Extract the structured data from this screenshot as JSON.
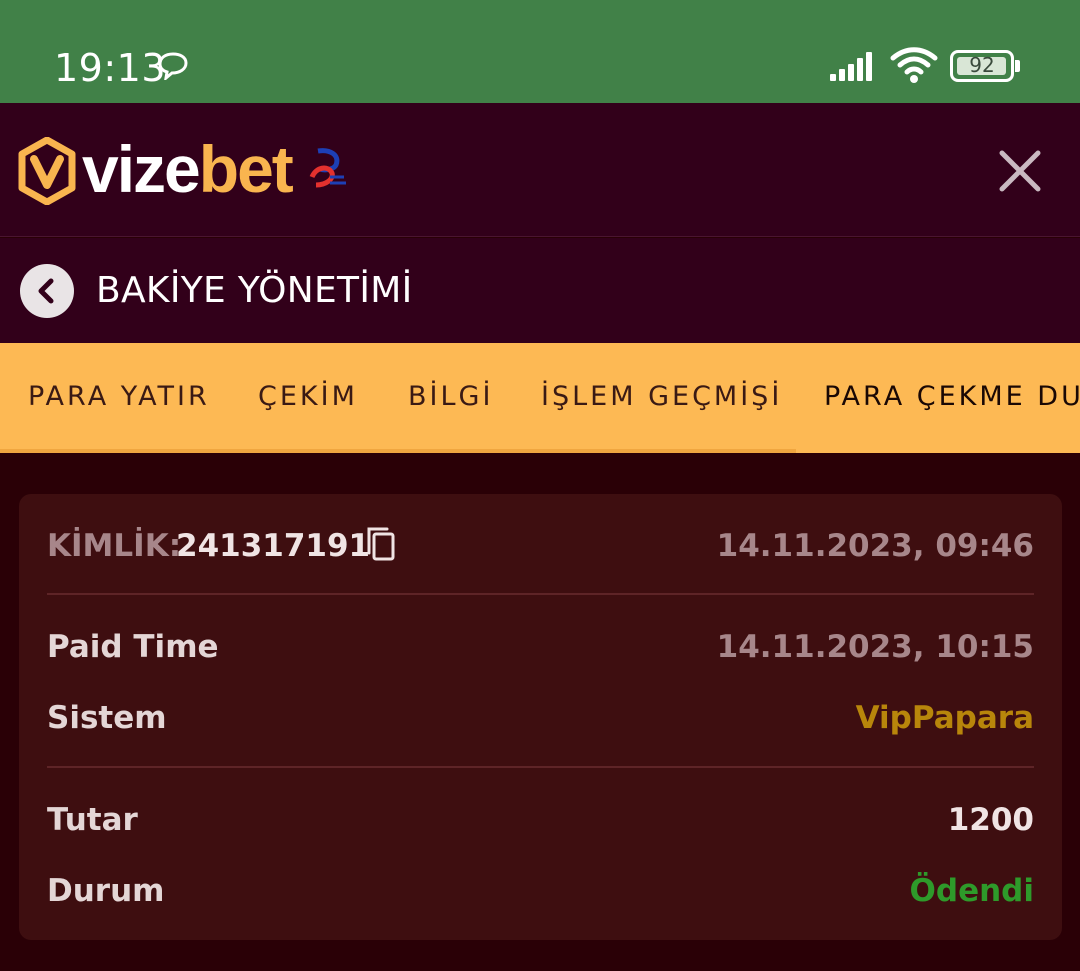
{
  "status_bar": {
    "time": "19:13",
    "battery": "92",
    "icons": [
      "chat-bubble-icon",
      "signal-icon",
      "wifi-icon",
      "battery-icon"
    ]
  },
  "header": {
    "logo_part1": "vize",
    "logo_part2": "bet",
    "logo_color": "#f9b54f",
    "close_icon": "close-icon"
  },
  "subheader": {
    "title": "BAKİYE YÖNETİMİ",
    "back_icon": "chevron-left-icon"
  },
  "tabs": [
    {
      "label": "PARA YATIR"
    },
    {
      "label": "ÇEKİM"
    },
    {
      "label": "BİLGİ"
    },
    {
      "label": "İŞLEM GEÇMİŞİ"
    },
    {
      "label": "PARA ÇEKME DUR"
    }
  ],
  "tab_bar_color": "#fdb954",
  "transaction": {
    "id_label": "KİMLİK:",
    "id_value": "241317191",
    "created": "14.11.2023, 09:46",
    "paid_time_label": "Paid Time",
    "paid_time_value": "14.11.2023, 10:15",
    "system_label": "Sistem",
    "system_value": "VipPapara",
    "system_color": "#b8860b",
    "amount_label": "Tutar",
    "amount_value": "1200",
    "status_label": "Durum",
    "status_value": "Ödendi",
    "status_color": "#2e9a2a"
  }
}
